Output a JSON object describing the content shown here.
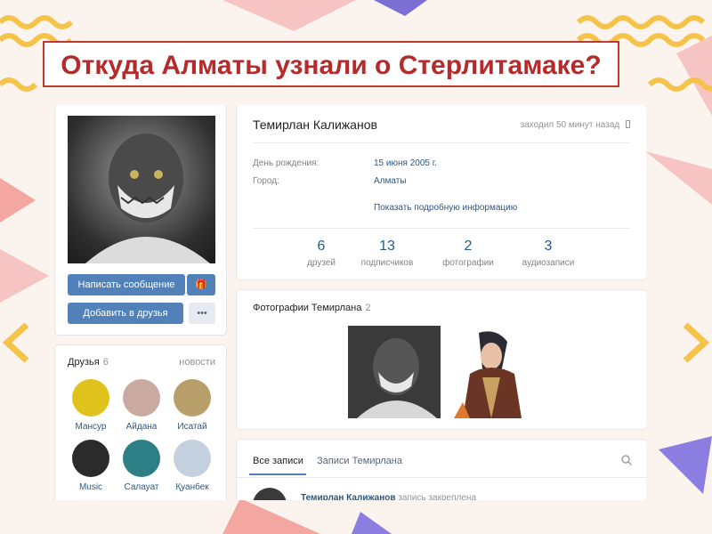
{
  "slide": {
    "title": "Откуда Алматы узнали о Стерлитамаке?"
  },
  "profile": {
    "name": "Темирлан Калижанов",
    "last_seen": "заходил 50 минут назад",
    "birthday_label": "День рождения:",
    "birthday_value": "15 июня 2005 г.",
    "city_label": "Город:",
    "city_value": "Алматы",
    "more_info_link": "Показать подробную информацию",
    "write_message_button": "Написать сообщение",
    "add_friend_button": "Добавить в друзья",
    "more_button": "•••"
  },
  "counters": [
    {
      "value": "6",
      "label": "друзей"
    },
    {
      "value": "13",
      "label": "подписчиков"
    },
    {
      "value": "2",
      "label": "фотографии"
    },
    {
      "value": "3",
      "label": "аудиозаписи"
    }
  ],
  "friends": {
    "title": "Друзья",
    "count": "6",
    "updates_link": "новости",
    "items": [
      {
        "name": "Мансур",
        "color": "#e0c21c"
      },
      {
        "name": "Айдана",
        "color": "#c9a9a0"
      },
      {
        "name": "Исатай",
        "color": "#b89f6a"
      },
      {
        "name": "Music",
        "color": "#2b2b2b"
      },
      {
        "name": "Салауат",
        "color": "#2d7f86"
      },
      {
        "name": "Қуанбек",
        "color": "#c3d0de"
      }
    ]
  },
  "photos": {
    "title": "Фотографии Темирлана",
    "count": "2"
  },
  "wall": {
    "tab_all": "Все записи",
    "tab_own": "Записи Темирлана",
    "post_author": "Темирлан Калижанов",
    "post_note": "запись закреплена"
  },
  "colors": {
    "accent": "#5181b8",
    "link": "#2a5885",
    "title_red": "#b52b2b"
  }
}
